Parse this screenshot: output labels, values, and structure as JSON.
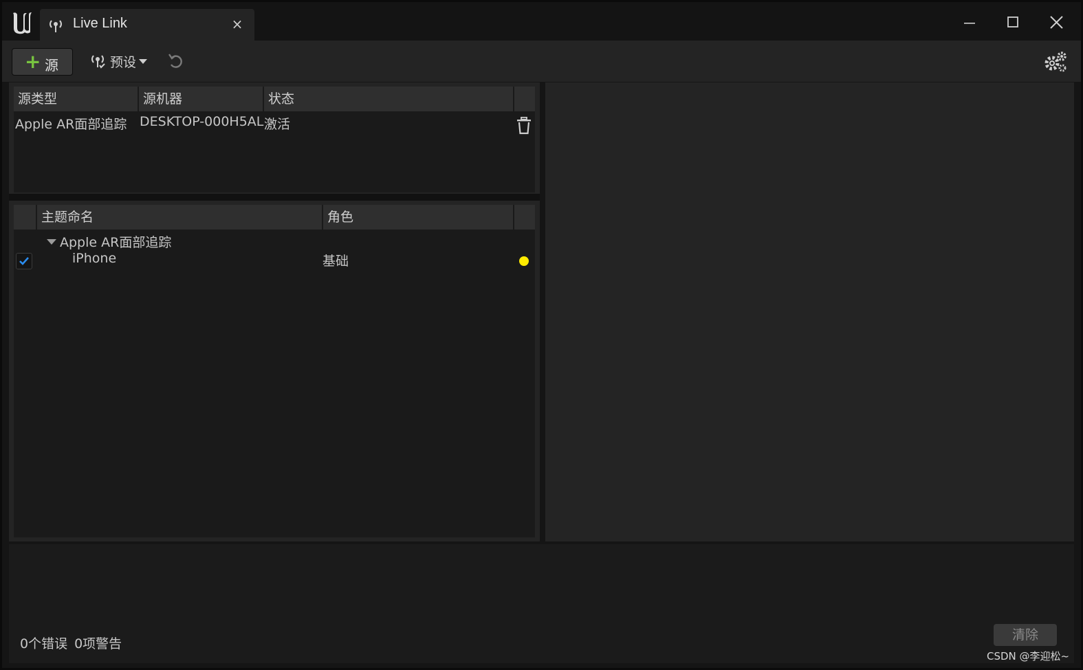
{
  "window": {
    "tab_title": "Live Link",
    "tab_close_glyph": "×"
  },
  "toolbar": {
    "add_source_label": "源",
    "presets_label": "预设"
  },
  "sources": {
    "columns": [
      "源类型",
      "源机器",
      "状态"
    ],
    "rows": [
      {
        "type": "Apple AR面部追踪",
        "machine": "DESKTOP-000H5AL",
        "status": "激活"
      }
    ]
  },
  "subjects": {
    "columns": [
      "主题命名",
      "角色"
    ],
    "groups": [
      {
        "name": "Apple AR面部追踪",
        "items": [
          {
            "name": "iPhone",
            "role": "基础",
            "enabled": true,
            "status_color": "#ffeb00"
          }
        ]
      }
    ]
  },
  "log": {
    "errors": "0个错误",
    "warnings": "0项警告",
    "clear_label": "清除"
  },
  "watermark": "CSDN @李迎松~",
  "colors": {
    "accent_green": "#78c440",
    "status_yellow": "#ffeb00",
    "check_blue": "#2b8df0"
  }
}
